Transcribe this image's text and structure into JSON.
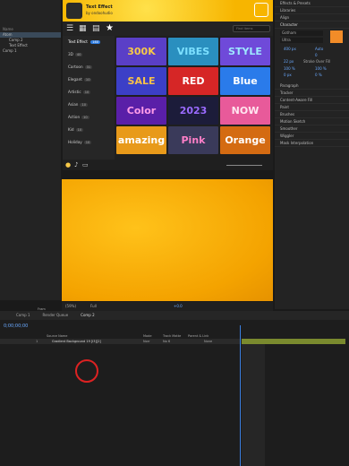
{
  "project": {
    "name_header": "Name",
    "items": [
      "Atom",
      "Comp 2",
      "Text Effect",
      "Comp 1"
    ]
  },
  "plugin": {
    "title": "Text Effect",
    "subtitle": "by ondoohudio",
    "search_placeholder": "Find Items",
    "category_header": "Text Effect",
    "category_count": "160",
    "categories": [
      {
        "label": "3D",
        "count": "40"
      },
      {
        "label": "Cartoon",
        "count": "31"
      },
      {
        "label": "Elegant",
        "count": "10"
      },
      {
        "label": "Artistic",
        "count": "10"
      },
      {
        "label": "Asian",
        "count": "10"
      },
      {
        "label": "Action",
        "count": "10"
      },
      {
        "label": "Kid",
        "count": "10"
      },
      {
        "label": "Holiday",
        "count": "10"
      }
    ],
    "tiles": [
      {
        "text": "300K",
        "bg": "#5a3fc7",
        "fg": "#f7c948"
      },
      {
        "text": "VIBES",
        "bg": "#2a8fbf",
        "fg": "#7ce0ff"
      },
      {
        "text": "STYLE",
        "bg": "#6f4ad9",
        "fg": "#9ee8ff"
      },
      {
        "text": "SALE",
        "bg": "#3c3fc7",
        "fg": "#f8c247"
      },
      {
        "text": "RED",
        "bg": "#d62626",
        "fg": "#ffffff"
      },
      {
        "text": "Blue",
        "bg": "#2a7bea",
        "fg": "#ffffff"
      },
      {
        "text": "Color",
        "bg": "#5a1fa8",
        "fg": "#ff9be8"
      },
      {
        "text": "2023",
        "bg": "#1c1c3a",
        "fg": "#9b6bff"
      },
      {
        "text": "NOW",
        "bg": "#e85a9a",
        "fg": "#ffe6f0"
      },
      {
        "text": "amazing",
        "bg": "#e89a1a",
        "fg": "#ffffff"
      },
      {
        "text": "Pink",
        "bg": "#3a3a5a",
        "fg": "#ff7fc8"
      },
      {
        "text": "Orange",
        "bg": "#d46b12",
        "fg": "#ffffff"
      }
    ]
  },
  "viewer": {
    "zoom": "(59%)",
    "resolution": "Full",
    "plus_value": "+0.0"
  },
  "right_panel": {
    "items": [
      "Effects & Presets",
      "Libraries",
      "Align",
      "Character",
      "Gotham",
      "Ultra",
      "Paragraph",
      "Tracker",
      "Content-Aware Fill",
      "Paint",
      "Brushes",
      "Motion Sketch",
      "Smoother",
      "Wiggler",
      "Mask Interpolation"
    ],
    "size_value": "400 px",
    "leading_value": "Auto",
    "tracking_value": "0",
    "stroke_value": "22 px",
    "stroke_mode": "Stroke Over Fill",
    "scale_v": "100 %",
    "scale_h": "100 %",
    "baseline": "0 px",
    "tsume": "0 %"
  },
  "timeline": {
    "tabs": [
      "Comp 1",
      "Render Queue",
      "Comp 2"
    ],
    "timecode": "0;00;00;00",
    "col_source": "Source Name",
    "col_mode": "Mode",
    "col_track": "Track Matte",
    "col_parent": "Parent & Link",
    "layer_index": "1",
    "layer_name": "Gradient Background 19 [I3][2]",
    "layer_mode": "Norr",
    "layer_track": "No 6",
    "layer_parent": "None",
    "frames_label": "Fram"
  }
}
